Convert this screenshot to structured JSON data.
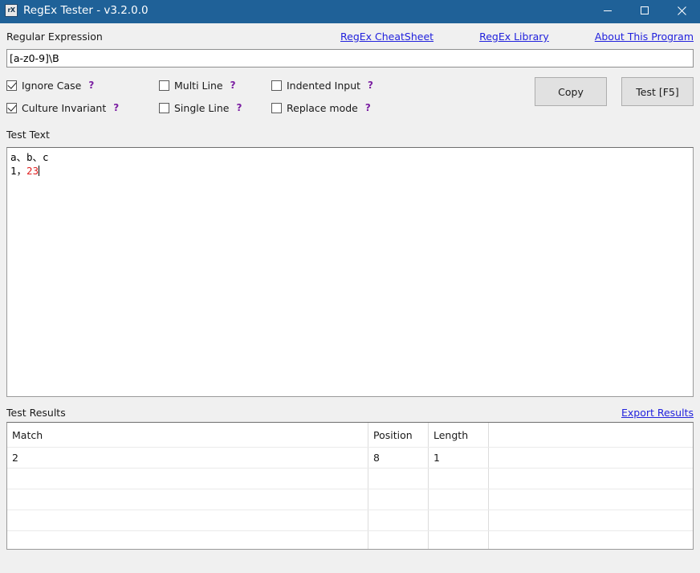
{
  "window": {
    "title": "RegEx Tester - v3.2.0.0",
    "icon_text": "rX",
    "icon_name": "app-icon",
    "minimize_label": "—",
    "maximize_label": "☐",
    "close_label": "✕",
    "titlebar_color": "#1f6198"
  },
  "regex_section": {
    "label": "Regular Expression",
    "value": "[a-z0-9]\\B",
    "links": [
      {
        "label": "RegEx CheatSheet"
      },
      {
        "label": "RegEx Library"
      },
      {
        "label": "About This Program"
      }
    ]
  },
  "options": [
    {
      "label": "Ignore Case",
      "checked": true,
      "help": "?"
    },
    {
      "label": "Multi Line",
      "checked": false,
      "help": "?"
    },
    {
      "label": "Indented Input",
      "checked": false,
      "help": "?"
    },
    {
      "label": "Culture Invariant",
      "checked": true,
      "help": "?"
    },
    {
      "label": "Single Line",
      "checked": false,
      "help": "?"
    },
    {
      "label": "Replace mode",
      "checked": false,
      "help": "?"
    }
  ],
  "buttons": {
    "copy": "Copy",
    "test": "Test [F5]"
  },
  "test_text": {
    "label": "Test Text",
    "line1": "a、b、c",
    "line2_prefix": "1，",
    "line2_match": "2",
    "line2_suffix": "3",
    "match_color": "#e02020"
  },
  "results": {
    "label": "Test Results",
    "export_link": "Export Results",
    "columns": [
      "Match",
      "Position",
      "Length",
      ""
    ],
    "rows": [
      [
        "2",
        "8",
        "1",
        ""
      ]
    ],
    "empty_row_count": 4
  },
  "colors": {
    "link": "#2222dd",
    "help": "#7b1fa2",
    "window_bg": "#f0f0f0"
  }
}
